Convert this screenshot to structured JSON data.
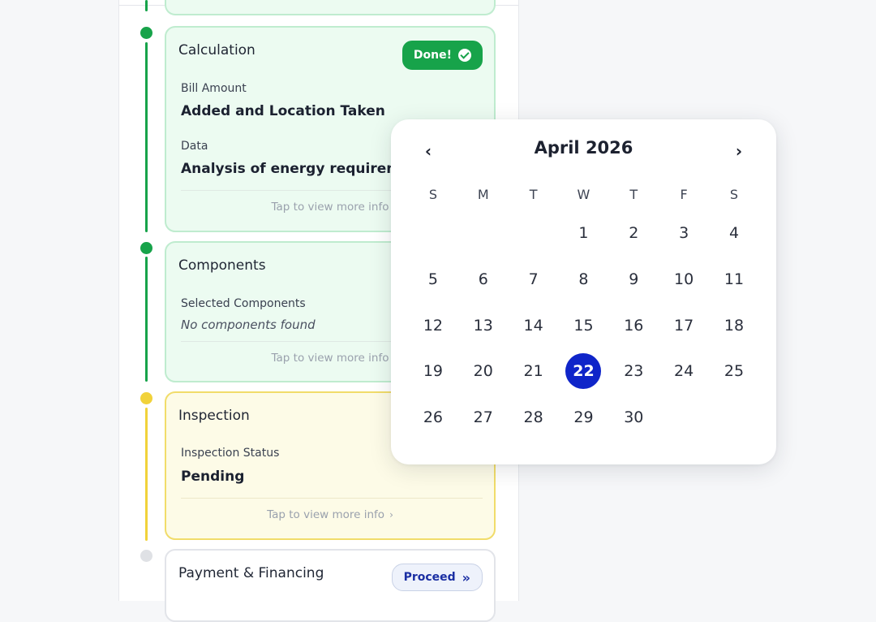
{
  "timeline": {
    "cards": [
      {
        "title": "Calculation",
        "status": "Done!",
        "fields": [
          {
            "label": "Bill Amount",
            "value": "Added and Location Taken"
          },
          {
            "label": "Data",
            "value": "Analysis of energy requirement"
          }
        ],
        "more": "Tap to view more info"
      },
      {
        "title": "Components",
        "fields": [
          {
            "label": "Selected Components",
            "value": "No components found"
          }
        ],
        "more": "Tap to view more info"
      },
      {
        "title": "Inspection",
        "fields": [
          {
            "label": "Inspection Status",
            "value": "Pending"
          }
        ],
        "more": "Tap to view more info"
      },
      {
        "title": "Payment & Financing",
        "action": "Proceed"
      }
    ]
  },
  "calendar": {
    "title": "April 2026",
    "weekdays": [
      "S",
      "M",
      "T",
      "W",
      "T",
      "F",
      "S"
    ],
    "weeks": [
      [
        "",
        "",
        "",
        "1",
        "2",
        "3",
        "4"
      ],
      [
        "5",
        "6",
        "7",
        "8",
        "9",
        "10",
        "11"
      ],
      [
        "12",
        "13",
        "14",
        "15",
        "16",
        "17",
        "18"
      ],
      [
        "19",
        "20",
        "21",
        "22",
        "23",
        "24",
        "25"
      ],
      [
        "26",
        "27",
        "28",
        "29",
        "30",
        "",
        ""
      ]
    ],
    "selected": "22"
  },
  "colors": {
    "done": "#17a34a",
    "pending": "#f1d23a",
    "selected": "#0f25c9",
    "proceed_text": "#1b2fa3"
  }
}
